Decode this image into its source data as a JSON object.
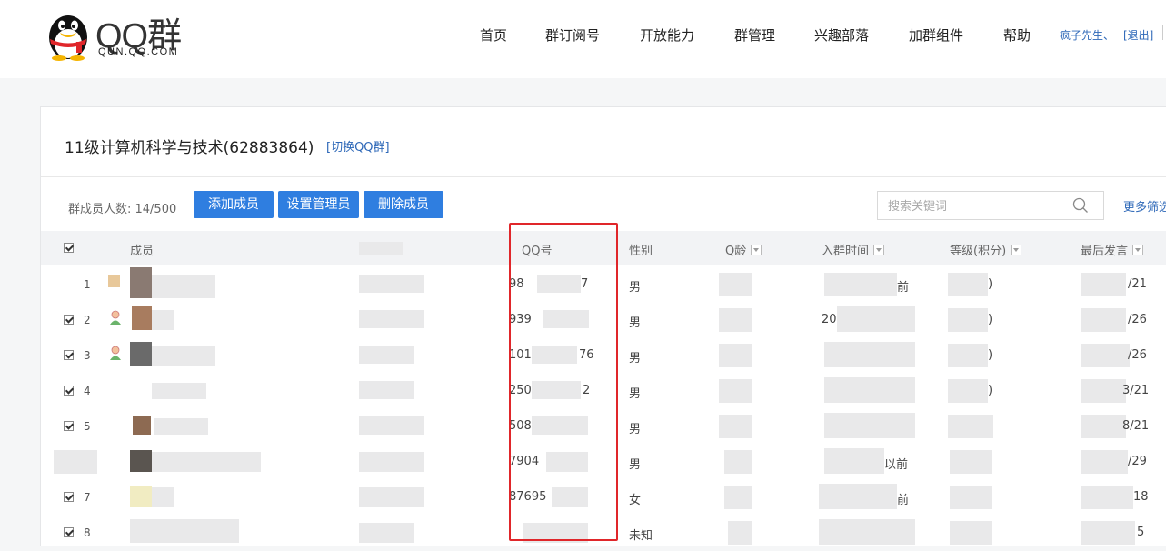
{
  "header": {
    "logo_text": "QQ群",
    "logo_sub": "QUN.QQ.COM",
    "nav": [
      "首页",
      "群订阅号",
      "开放能力",
      "群管理",
      "兴趣部落",
      "加群组件",
      "帮助"
    ],
    "user_name": "疯子先生、",
    "logout": "[退出]"
  },
  "group": {
    "title": "11级计算机科学与技术(62883864)",
    "switch_label": "[切换QQ群]"
  },
  "toolbar": {
    "member_count": "群成员人数: 14/500",
    "add_label": "添加成员",
    "set_admin_label": "设置管理员",
    "delete_label": "删除成员",
    "search_placeholder": "搜索关键词",
    "more_filter": "更多筛选"
  },
  "table": {
    "columns": [
      "成员",
      "QQ号",
      "性别",
      "Q龄",
      "入群时间",
      "等级(积分)",
      "最后发言"
    ],
    "rows": [
      {
        "index": "1",
        "checked": false,
        "qq_partial": "98",
        "qq_end": "7",
        "gender": "男",
        "join_suffix": "前",
        "level_end": ")",
        "last_end": "/21"
      },
      {
        "index": "2",
        "checked": true,
        "qq_partial": "939",
        "qq_end": "",
        "gender": "男",
        "join_suffix": "",
        "level_end": ")",
        "last_end": "/26"
      },
      {
        "index": "3",
        "checked": true,
        "qq_partial": "101",
        "qq_end": "76",
        "gender": "男",
        "join_suffix": "",
        "level_end": ")",
        "last_end": "/26"
      },
      {
        "index": "4",
        "checked": true,
        "qq_partial": "250",
        "qq_end": "2",
        "gender": "男",
        "join_suffix": "",
        "level_end": ")",
        "last_end": "3/21"
      },
      {
        "index": "5",
        "checked": true,
        "qq_partial": "508",
        "qq_end": "",
        "gender": "男",
        "join_suffix": "",
        "level_end": "",
        "last_end": "8/21"
      },
      {
        "index": "",
        "checked": false,
        "qq_partial": "7904",
        "qq_end": "",
        "gender": "男",
        "join_suffix": "以前",
        "level_end": "",
        "last_end": "/29"
      },
      {
        "index": "7",
        "checked": true,
        "qq_partial": "87695",
        "qq_end": "",
        "gender": "女",
        "join_suffix": "前",
        "level_end": "",
        "last_end": "18"
      },
      {
        "index": "8",
        "checked": true,
        "qq_partial": "",
        "qq_end": "",
        "gender": "未知",
        "join_suffix": "",
        "level_end": "",
        "last_end": "5"
      }
    ]
  },
  "colors": {
    "accent": "#2f7ee0",
    "link": "#2e68b8",
    "highlight": "#e0262a"
  }
}
